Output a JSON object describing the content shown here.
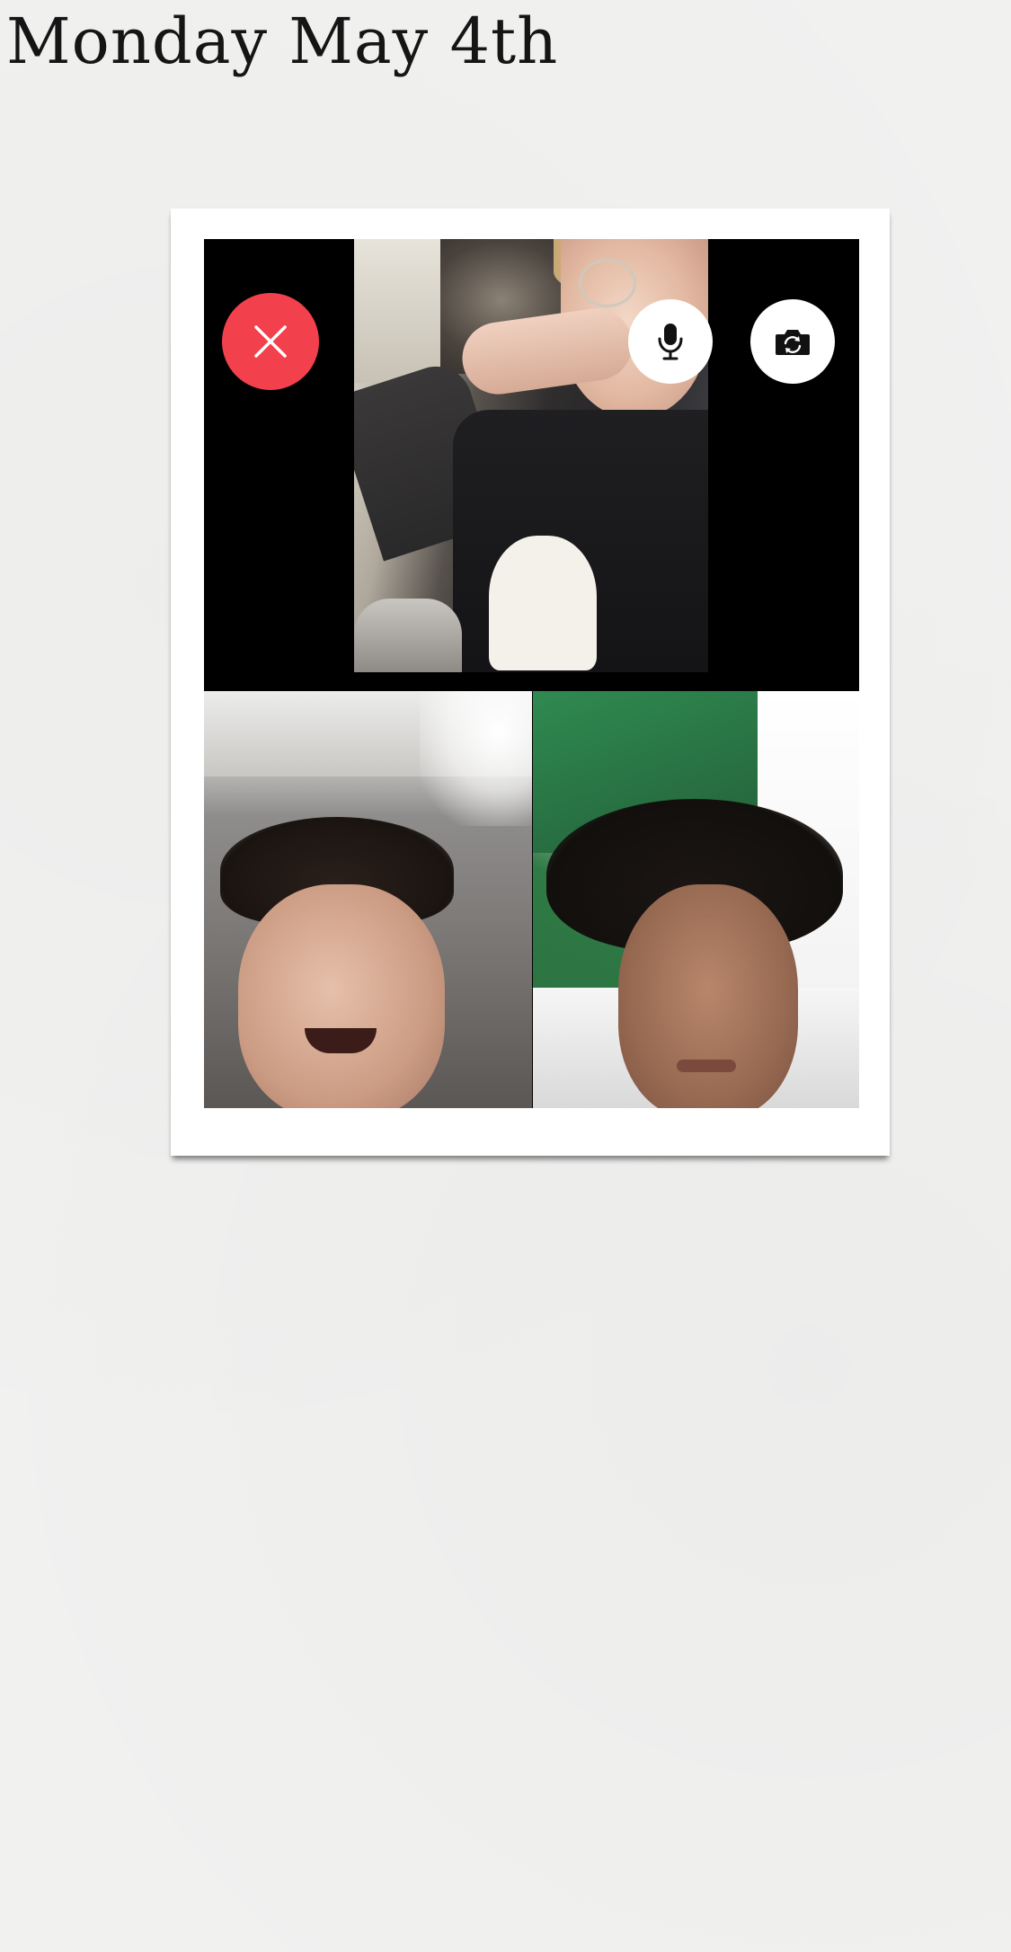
{
  "page": {
    "title": "Monday May 4th"
  },
  "call": {
    "end_button_icon": "close-icon",
    "mute_button_icon": "microphone-icon",
    "flip_button_icon": "camera-flip-icon",
    "end_button_color": "#f2404c",
    "control_button_color": "#ffffff",
    "screen_background": "#000000"
  },
  "photo_frame": {
    "background": "#ffffff"
  },
  "page_background": "#f1f1f0"
}
